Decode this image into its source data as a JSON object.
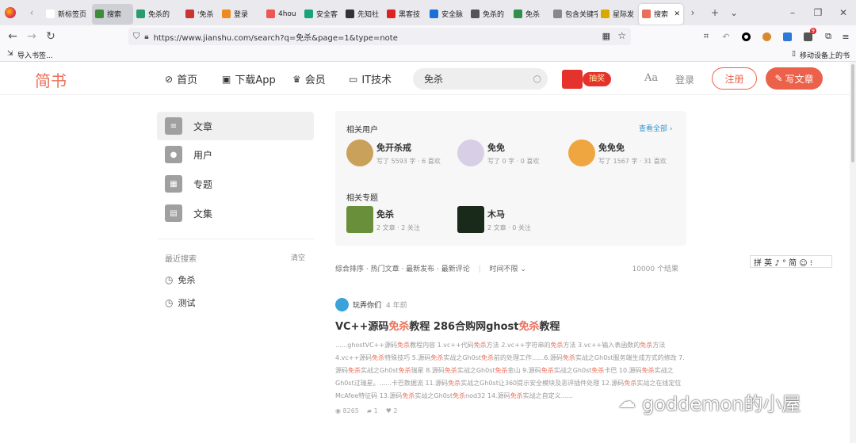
{
  "browser": {
    "tabs": [
      {
        "label": "新标签页",
        "color": "#ffffff"
      },
      {
        "label": "搜索",
        "color": "#3c8c3c",
        "highlighted": true
      },
      {
        "label": "免杀的",
        "color": "#2b9c6c"
      },
      {
        "label": "'免杀",
        "color": "#c33"
      },
      {
        "label": "登录",
        "color": "#ef8a1e"
      },
      {
        "label": "4hou",
        "color": "#e55"
      },
      {
        "label": "安全客",
        "color": "#1aa37a"
      },
      {
        "label": "先知社",
        "color": "#333"
      },
      {
        "label": "黑客技",
        "color": "#d22"
      },
      {
        "label": "安全脉",
        "color": "#1b6fd6"
      },
      {
        "label": "免杀的",
        "color": "#555"
      },
      {
        "label": "免杀",
        "color": "#2f8f4b"
      },
      {
        "label": "包含关键字",
        "color": "#888"
      },
      {
        "label": "星际发",
        "color": "#d9a900"
      },
      {
        "label": "搜索",
        "color": "#ea6f5a",
        "active": true
      }
    ],
    "url": "https://www.jianshu.com/search?q=免杀&page=1&type=note",
    "bookmarks_import": "导入书签...",
    "mobile_bookmarks": "移动设备上的书签",
    "badge_count": "9"
  },
  "site": {
    "logo": "简书",
    "nav": [
      {
        "label": "首页",
        "icon": "compass-icon"
      },
      {
        "label": "下载App",
        "icon": "phone-icon"
      },
      {
        "label": "会员",
        "icon": "crown-icon"
      },
      {
        "label": "IT技术",
        "icon": "code-icon"
      }
    ],
    "search_value": "免杀",
    "lottery": "抽奖",
    "font_toggle": "Aa",
    "login": "登录",
    "register": "注册",
    "write": "写文章",
    "accent": "#ea6f5a"
  },
  "sidebar": {
    "types": [
      {
        "label": "文章",
        "icon": "article-icon",
        "active": true
      },
      {
        "label": "用户",
        "icon": "user-icon"
      },
      {
        "label": "专题",
        "icon": "collection-icon"
      },
      {
        "label": "文集",
        "icon": "notebook-icon"
      }
    ],
    "recent_title": "最近搜索",
    "clear": "清空",
    "recent": [
      "免杀",
      "测试"
    ]
  },
  "related": {
    "users_title": "相关用户",
    "view_all": "查看全部 ›",
    "users": [
      {
        "name": "免开杀戒",
        "meta": "写了 5593 字 · 6 喜欢",
        "avatar_color": "#c9a15a"
      },
      {
        "name": "免免",
        "meta": "写了 0 字 · 0 喜欢",
        "avatar_color": "#d8cfe6"
      },
      {
        "name": "免免免",
        "meta": "写了 1567 字 · 31 喜欢",
        "avatar_color": "#f0a640"
      }
    ],
    "topics_title": "相关专题",
    "topics": [
      {
        "name": "免杀",
        "meta": "2 文章 · 2 关注",
        "img_color": "#6a8f3a"
      },
      {
        "name": "木马",
        "meta": "2 文章 · 0 关注",
        "img_color": "#1a2a1a"
      }
    ]
  },
  "sort": {
    "options": "综合排序 · 热门文章 · 最新发布 · 最新评论",
    "time": "时间不限 ⌄",
    "results": "10000 个结果"
  },
  "article": {
    "author": "玩弄你们",
    "time": "4 年前",
    "title_parts": [
      "VC++源码",
      "免杀",
      "教程 286合购网ghost",
      "免杀",
      "教程"
    ],
    "body": "......ghostVC++源码免杀教程内容 1.vc++代码免杀方法 2.vc++字符串的免杀方法 3.vc++输入表函数的免杀方法 4.vc++源码免杀特殊技巧 5.源码免杀实战之Gh0st免杀前的处理工作......6.源码免杀实战之Gh0st服务端生成方式的修改 7.源码免杀实战之Gh0st免杀瑞星 8.源码免杀实战之Gh0st免杀金山 9.源码免杀实战之Gh0st免杀卡巴 10.源码免杀实战之Gh0st过瑞星。......卡巴数据流 11.源码免杀实战之Gh0st让360提示安全模块及恶评插件处理 12.源码免杀实战之在线定位McAfee特征码 13.源码免杀实战之Gh0st免杀nod32 14.源码免杀实战之自定义......",
    "views": "8265",
    "comments": "1",
    "likes": "2"
  },
  "ime": "拼 英 ♪ ° 简 ☺ ⁝",
  "watermark": "goddemon的小屋"
}
